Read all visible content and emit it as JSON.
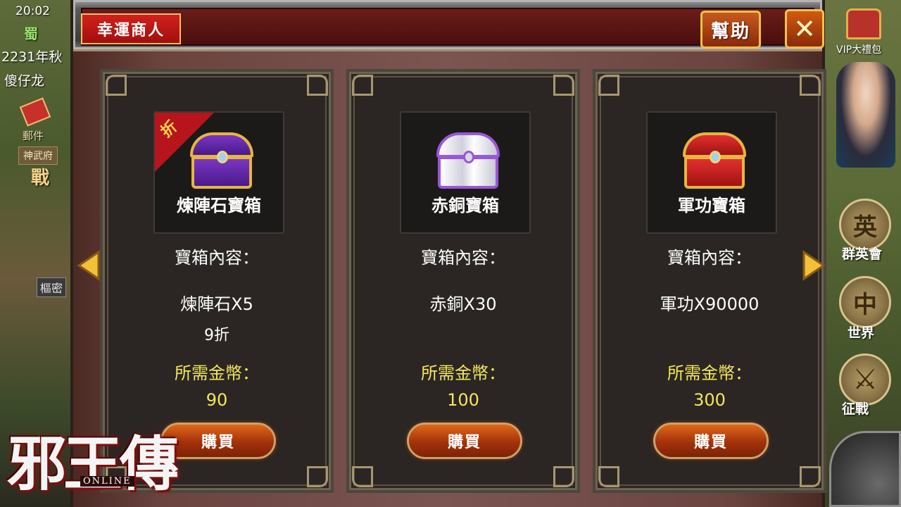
{
  "hud": {
    "time": "20:02",
    "kingdom": "蜀",
    "year": "2231年秋",
    "player": "傻仔龙",
    "mail_label": "郵件",
    "shenwu_label": "神武府",
    "war_label": "戰",
    "secret_label": "樞密"
  },
  "right_hud": {
    "vip_label": "VIP大禮包",
    "heroes_label": "群英會",
    "heroes_icon": "英",
    "world_label": "世界",
    "world_icon": "中",
    "battle_label": "征戰"
  },
  "dialog": {
    "title": "幸運商人",
    "help_label": "幫助",
    "close_label": "✕"
  },
  "cards": [
    {
      "item_name": "煉陣石寶箱",
      "content_label": "寶箱內容：",
      "content_value": "煉陣石X5",
      "discount_badge": "折",
      "discount_value": "9折",
      "gold_label": "所需金幣：",
      "gold_value": "90",
      "buy_label": "購買",
      "chest_color": "#7a36c4"
    },
    {
      "item_name": "赤銅寶箱",
      "content_label": "寶箱內容：",
      "content_value": "赤銅X30",
      "gold_label": "所需金幣：",
      "gold_value": "100",
      "buy_label": "購買",
      "chest_color": "#d0d0dc"
    },
    {
      "item_name": "軍功寶箱",
      "content_label": "寶箱內容：",
      "content_value": "軍功X90000",
      "gold_label": "所需金幣：",
      "gold_value": "300",
      "buy_label": "購買",
      "chest_color": "#e23030"
    }
  ],
  "logo": {
    "title": "邪王傳",
    "subtitle": "ONLINE"
  },
  "colors": {
    "gold_text": "#f3e75a",
    "title_tab": "#d3201c",
    "button_orange": "#e0671a"
  }
}
